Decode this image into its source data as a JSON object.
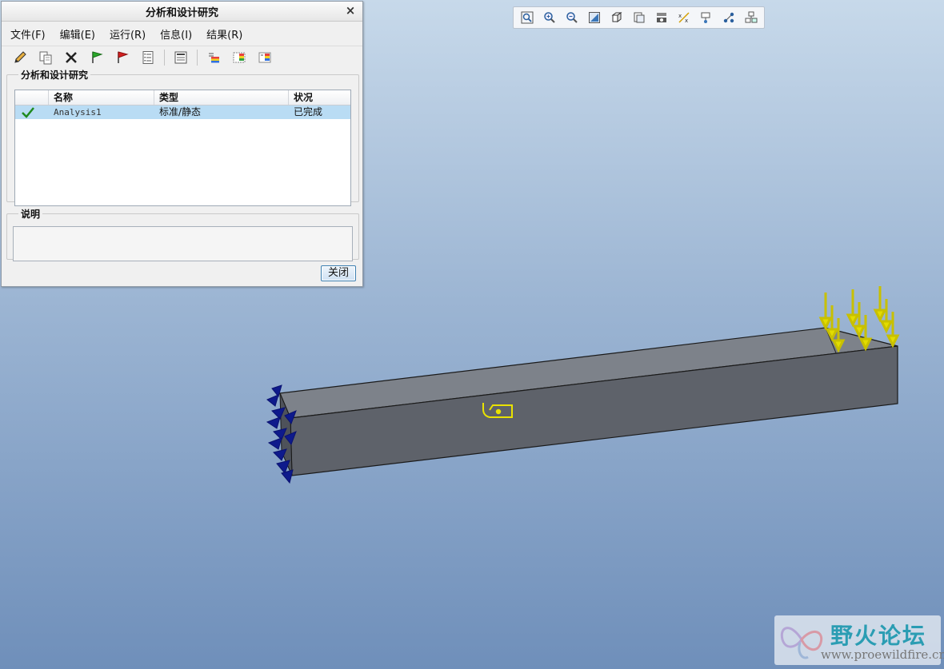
{
  "dialog": {
    "title": "分析和设计研究",
    "close_glyph": "×",
    "menu": [
      "文件(F)",
      "编辑(E)",
      "运行(R)",
      "信息(I)",
      "结果(R)"
    ],
    "group_analyses": "分析和设计研究",
    "table": {
      "headers": [
        "",
        "名称",
        "类型",
        "状况"
      ],
      "rows": [
        {
          "status_icon": "check-icon",
          "name": "Analysis1",
          "type": "标准/静态",
          "status": "已完成"
        }
      ]
    },
    "group_description": "说明",
    "close_button": "关闭"
  },
  "toolbar_icons": [
    "pencil-icon",
    "copy-icon",
    "delete-icon",
    "green-flag-icon",
    "red-flag-icon",
    "checklist-icon",
    "info-icon",
    "results-icon",
    "results-alt-icon",
    "results-export-icon"
  ],
  "gfx_toolbar_icons": [
    "zoom-fit-icon",
    "zoom-in-icon",
    "zoom-out-icon",
    "repaint-icon",
    "view-orientation-icon",
    "saved-views-icon",
    "display-style-icon",
    "datum-display-icon",
    "spin-center-icon",
    "csys-icon",
    "mesh-icon"
  ],
  "watermark": {
    "title": "野火论坛",
    "url": "www.proewildfire.cn"
  },
  "colors": {
    "beam_top": "#7b8088",
    "beam_side": "#5f636b",
    "load": "#d9d200",
    "constraint": "#0e1a8c"
  }
}
